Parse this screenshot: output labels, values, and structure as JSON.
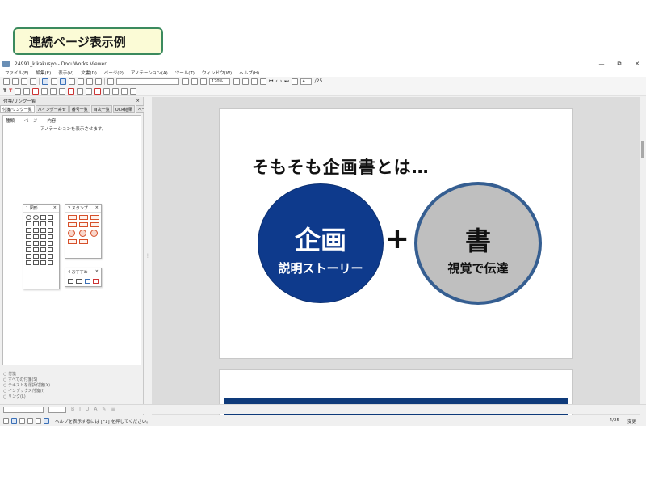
{
  "slide_label": "連続ページ表示例",
  "window": {
    "title": "24991_kikakusyo - DocuWorks Viewer",
    "controls": [
      "—",
      "⧉",
      "✕"
    ]
  },
  "menu": [
    "ファイル(F)",
    "編集(E)",
    "表示(V)",
    "文書(D)",
    "ページ(P)",
    "アノテーション(A)",
    "ツール(T)",
    "ウィンドウ(W)",
    "ヘルプ(H)"
  ],
  "toolbar": {
    "zoom_value": "120%",
    "page_current": "4",
    "page_total": "/25"
  },
  "sidepanel": {
    "title": "付箋/リンク一覧",
    "close_icon": "×",
    "tabs": [
      "付箋/リンク一覧",
      "バインダー寄せ",
      "番号一覧",
      "目次一覧",
      "OCR結果",
      "ページ属性"
    ],
    "columns": [
      "種類",
      "ページ",
      "内容"
    ],
    "empty_text": "アノテーションを表示させます。",
    "palettes": {
      "shapes": "1 図形",
      "stamps": "2 スタンプ",
      "recommended": "4 おすすめ"
    },
    "options": [
      "付箋",
      "すべての付箋(S)",
      "テキストを選択付箋(X)",
      "インデックス付箋(I)",
      "リンク(L)"
    ]
  },
  "page": {
    "heading": "そもそも企画書とは…",
    "left_circle": {
      "title": "企画",
      "subtitle": "説明ストーリー",
      "color": "#0e3a8c"
    },
    "plus": "+",
    "right_circle": {
      "title": "書",
      "subtitle": "視覚で伝達",
      "color": "#bfbfbf",
      "border": "#355e91"
    }
  },
  "status": {
    "message": "ヘルプを表示するには [F1] を押してください。",
    "page_indicator": "4/25",
    "mode": "変更"
  }
}
